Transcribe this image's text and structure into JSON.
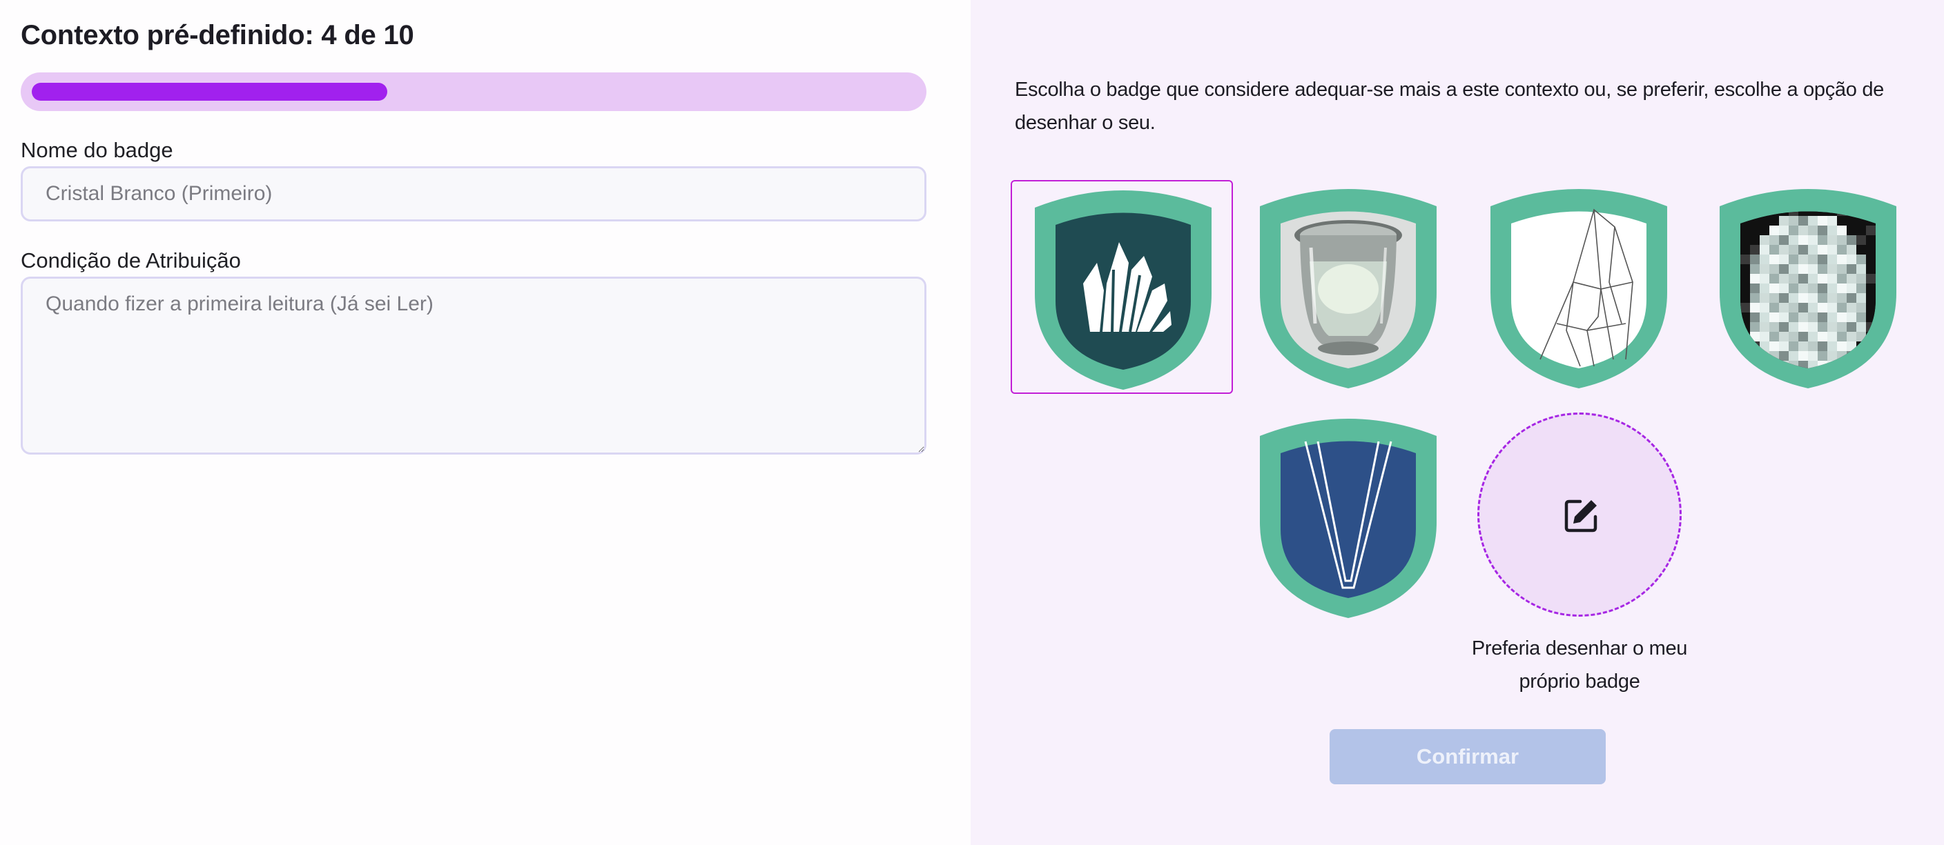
{
  "context": {
    "title": "Contexto pré-definido: 4 de 10",
    "progress_fraction": 0.4,
    "colors": {
      "track": "#e8c8f6",
      "fill": "#a121ee"
    }
  },
  "form": {
    "name_label": "Nome do badge",
    "name_placeholder": "Cristal Branco (Primeiro)",
    "condition_label": "Condição de Atribuição",
    "condition_placeholder": "Quando fizer a primeira leitura (Já sei Ler)"
  },
  "chooser": {
    "instructions": "Escolha o badge que considere adequar-se mais a este contexto ou, se preferir, escolhe a opção de desenhar o seu.",
    "badges": [
      {
        "icon": "crystal-cluster-icon",
        "selected": true
      },
      {
        "icon": "glass-of-water-icon",
        "selected": false
      },
      {
        "icon": "sketched-crystal-icon",
        "selected": false
      },
      {
        "icon": "pixel-crystal-icon",
        "selected": false
      },
      {
        "icon": "blue-crystal-icon",
        "selected": false
      }
    ],
    "draw_option": {
      "icon": "edit-pencil-icon",
      "caption": "Preferia desenhar o meu próprio badge"
    },
    "confirm_label": "Confirmar",
    "shield_color": "#5bbb9c",
    "selection_color": "#c21fd6"
  }
}
